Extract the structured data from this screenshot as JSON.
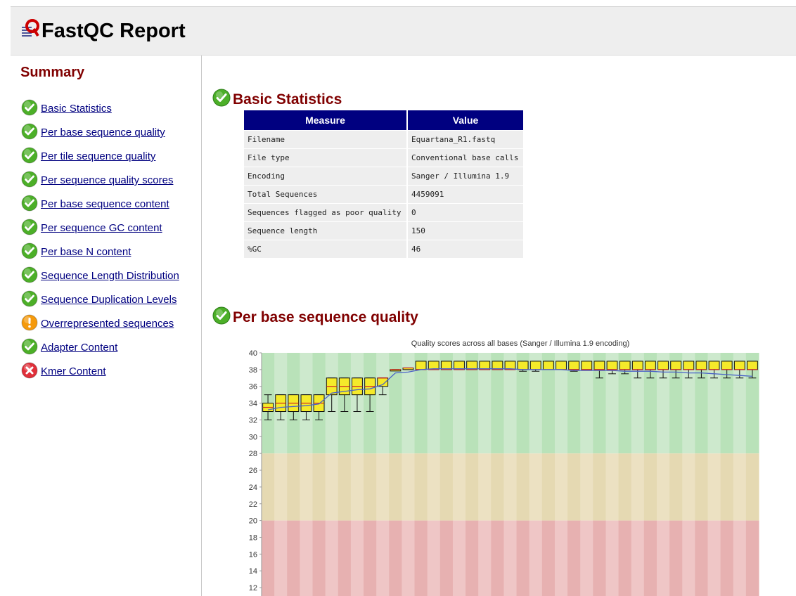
{
  "header": {
    "title": "FastQC Report"
  },
  "summary": {
    "title": "Summary",
    "items": [
      {
        "label": "Basic Statistics",
        "status": "pass"
      },
      {
        "label": "Per base sequence quality",
        "status": "pass"
      },
      {
        "label": "Per tile sequence quality",
        "status": "pass"
      },
      {
        "label": "Per sequence quality scores",
        "status": "pass"
      },
      {
        "label": "Per base sequence content",
        "status": "pass"
      },
      {
        "label": "Per sequence GC content",
        "status": "pass"
      },
      {
        "label": "Per base N content",
        "status": "pass"
      },
      {
        "label": "Sequence Length Distribution",
        "status": "pass"
      },
      {
        "label": "Sequence Duplication Levels",
        "status": "pass"
      },
      {
        "label": "Overrepresented sequences",
        "status": "warn"
      },
      {
        "label": "Adapter Content",
        "status": "pass"
      },
      {
        "label": "Kmer Content",
        "status": "fail"
      }
    ]
  },
  "status_colors": {
    "pass": "#4caf28",
    "warn": "#f59a0c",
    "fail": "#e0303a"
  },
  "basic_statistics": {
    "title": "Basic Statistics",
    "headers": [
      "Measure",
      "Value"
    ],
    "rows": [
      [
        "Filename",
        "Equartana_R1.fastq"
      ],
      [
        "File type",
        "Conventional base calls"
      ],
      [
        "Encoding",
        "Sanger / Illumina 1.9"
      ],
      [
        "Total Sequences",
        "4459091"
      ],
      [
        "Sequences flagged as poor quality",
        "0"
      ],
      [
        "Sequence length",
        "150"
      ],
      [
        "%GC",
        "46"
      ]
    ]
  },
  "per_base_quality": {
    "title": "Per base sequence quality",
    "chart_data": {
      "type": "boxplot",
      "title": "Quality scores across all bases (Sanger / Illumina 1.9 encoding)",
      "y_ticks": [
        40,
        38,
        36,
        34,
        32,
        30,
        28,
        26,
        24,
        22,
        20,
        18,
        16,
        14,
        12
      ],
      "y_visible_range": [
        11,
        40
      ],
      "quality_zones": [
        {
          "name": "good",
          "from": 28,
          "to": 40,
          "colors": [
            "#b9e2b9",
            "#cde9cd"
          ]
        },
        {
          "name": "reasonable",
          "from": 20,
          "to": 28,
          "colors": [
            "#e5d9b2",
            "#ece1c2"
          ]
        },
        {
          "name": "poor",
          "from": 0,
          "to": 20,
          "colors": [
            "#e7b1b1",
            "#efc6c6"
          ]
        }
      ],
      "box_color": "#f5ea2a",
      "median_color": "#cc2222",
      "mean_line_color": "#4a62c8",
      "boxes": [
        {
          "q1": 33.0,
          "q3": 34.0,
          "median": 33.5,
          "lw": 32.0,
          "uw": 35.0,
          "mean": 33.2
        },
        {
          "q1": 33.0,
          "q3": 35.0,
          "median": 34.0,
          "lw": 32.0,
          "uw": 35.0,
          "mean": 33.5
        },
        {
          "q1": 33.0,
          "q3": 35.0,
          "median": 34.0,
          "lw": 32.0,
          "uw": 35.0,
          "mean": 33.6
        },
        {
          "q1": 33.0,
          "q3": 35.0,
          "median": 34.0,
          "lw": 32.0,
          "uw": 35.0,
          "mean": 33.7
        },
        {
          "q1": 33.0,
          "q3": 35.0,
          "median": 34.0,
          "lw": 32.0,
          "uw": 35.0,
          "mean": 33.9
        },
        {
          "q1": 35.0,
          "q3": 37.0,
          "median": 36.0,
          "lw": 33.0,
          "uw": 37.0,
          "mean": 35.2
        },
        {
          "q1": 35.0,
          "q3": 37.0,
          "median": 36.0,
          "lw": 33.0,
          "uw": 37.0,
          "mean": 35.4
        },
        {
          "q1": 35.0,
          "q3": 37.0,
          "median": 36.0,
          "lw": 33.0,
          "uw": 37.0,
          "mean": 35.6
        },
        {
          "q1": 35.0,
          "q3": 37.0,
          "median": 36.0,
          "lw": 33.0,
          "uw": 37.0,
          "mean": 35.7
        },
        {
          "q1": 36.0,
          "q3": 37.0,
          "median": 37.0,
          "lw": 35.0,
          "uw": 37.0,
          "mean": 36.2
        },
        {
          "q1": 38.0,
          "q3": 38.0,
          "median": 38.0,
          "lw": 38.0,
          "uw": 38.0,
          "mean": 37.6
        },
        {
          "q1": 38.0,
          "q3": 38.2,
          "median": 38.2,
          "lw": 38.0,
          "uw": 38.2,
          "mean": 37.7
        },
        {
          "q1": 38.0,
          "q3": 39.0,
          "median": 38.0,
          "lw": 38.0,
          "uw": 39.0,
          "mean": 38.0
        },
        {
          "q1": 38.0,
          "q3": 39.0,
          "median": 38.0,
          "lw": 38.0,
          "uw": 39.0,
          "mean": 38.1
        },
        {
          "q1": 38.0,
          "q3": 39.0,
          "median": 38.0,
          "lw": 38.0,
          "uw": 39.0,
          "mean": 38.1
        },
        {
          "q1": 38.0,
          "q3": 39.0,
          "median": 38.0,
          "lw": 38.0,
          "uw": 39.0,
          "mean": 38.1
        },
        {
          "q1": 38.0,
          "q3": 39.0,
          "median": 38.0,
          "lw": 38.0,
          "uw": 39.0,
          "mean": 38.1
        },
        {
          "q1": 38.0,
          "q3": 39.0,
          "median": 38.0,
          "lw": 38.0,
          "uw": 39.0,
          "mean": 38.1
        },
        {
          "q1": 38.0,
          "q3": 39.0,
          "median": 38.0,
          "lw": 38.0,
          "uw": 39.0,
          "mean": 38.1
        },
        {
          "q1": 38.0,
          "q3": 39.0,
          "median": 38.0,
          "lw": 38.0,
          "uw": 39.0,
          "mean": 38.1
        },
        {
          "q1": 38.0,
          "q3": 39.0,
          "median": 38.0,
          "lw": 37.8,
          "uw": 39.0,
          "mean": 38.0
        },
        {
          "q1": 38.0,
          "q3": 39.0,
          "median": 38.0,
          "lw": 37.8,
          "uw": 39.0,
          "mean": 38.0
        },
        {
          "q1": 38.0,
          "q3": 39.0,
          "median": 38.0,
          "lw": 38.0,
          "uw": 39.0,
          "mean": 38.0
        },
        {
          "q1": 38.0,
          "q3": 39.0,
          "median": 38.0,
          "lw": 38.0,
          "uw": 39.0,
          "mean": 38.0
        },
        {
          "q1": 38.0,
          "q3": 39.0,
          "median": 38.0,
          "lw": 37.8,
          "uw": 39.0,
          "mean": 37.9
        },
        {
          "q1": 38.0,
          "q3": 39.0,
          "median": 38.0,
          "lw": 38.0,
          "uw": 39.0,
          "mean": 37.9
        },
        {
          "q1": 38.0,
          "q3": 39.0,
          "median": 38.0,
          "lw": 37.0,
          "uw": 39.0,
          "mean": 37.9
        },
        {
          "q1": 38.0,
          "q3": 39.0,
          "median": 38.0,
          "lw": 37.5,
          "uw": 39.0,
          "mean": 37.9
        },
        {
          "q1": 38.0,
          "q3": 39.0,
          "median": 38.0,
          "lw": 37.5,
          "uw": 39.0,
          "mean": 37.8
        },
        {
          "q1": 38.0,
          "q3": 39.0,
          "median": 38.0,
          "lw": 37.0,
          "uw": 39.0,
          "mean": 37.8
        },
        {
          "q1": 38.0,
          "q3": 39.0,
          "median": 38.0,
          "lw": 37.0,
          "uw": 39.0,
          "mean": 37.8
        },
        {
          "q1": 38.0,
          "q3": 39.0,
          "median": 38.0,
          "lw": 37.0,
          "uw": 39.0,
          "mean": 37.7
        },
        {
          "q1": 38.0,
          "q3": 39.0,
          "median": 38.0,
          "lw": 37.0,
          "uw": 39.0,
          "mean": 37.7
        },
        {
          "q1": 38.0,
          "q3": 39.0,
          "median": 38.0,
          "lw": 37.0,
          "uw": 39.0,
          "mean": 37.6
        },
        {
          "q1": 38.0,
          "q3": 39.0,
          "median": 38.0,
          "lw": 37.0,
          "uw": 39.0,
          "mean": 37.6
        },
        {
          "q1": 38.0,
          "q3": 39.0,
          "median": 38.0,
          "lw": 37.0,
          "uw": 39.0,
          "mean": 37.5
        },
        {
          "q1": 38.0,
          "q3": 39.0,
          "median": 38.0,
          "lw": 37.0,
          "uw": 39.0,
          "mean": 37.4
        },
        {
          "q1": 38.0,
          "q3": 39.0,
          "median": 38.0,
          "lw": 37.0,
          "uw": 39.0,
          "mean": 37.3
        },
        {
          "q1": 38.0,
          "q3": 39.0,
          "median": 38.0,
          "lw": 37.0,
          "uw": 39.0,
          "mean": 37.2
        }
      ]
    }
  }
}
